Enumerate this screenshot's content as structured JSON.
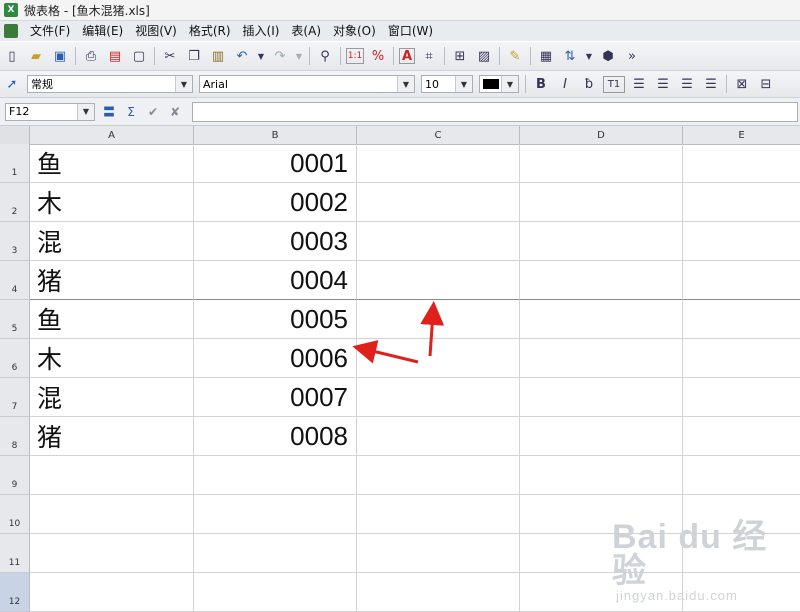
{
  "window": {
    "title": "微表格 - [鱼木混猪.xls]"
  },
  "menu": [
    "文件(F)",
    "编辑(E)",
    "视图(V)",
    "格式(R)",
    "插入(I)",
    "表(A)",
    "对象(O)",
    "窗口(W)"
  ],
  "toolbar": {
    "icons": [
      "new-file-icon",
      "open-folder-icon",
      "save-icon",
      "print-icon",
      "export-pdf-icon",
      "print-preview-icon",
      "cut-icon",
      "copy-icon",
      "paste-icon",
      "undo-icon",
      "redo-icon",
      "find-icon",
      "number-format-icon",
      "percent-icon",
      "text-frame-icon",
      "grid-icon",
      "borders-icon",
      "pattern-icon",
      "format-painter-icon",
      "chart-icon",
      "sort-icon",
      "gear-icon"
    ],
    "more": "»"
  },
  "format": {
    "style": "常规",
    "font": "Arial",
    "size": "10",
    "bold": "B",
    "italic": "I",
    "text_style": "T1"
  },
  "formula": {
    "cell_ref": "F12",
    "value": ""
  },
  "columns": [
    "A",
    "B",
    "C",
    "D",
    "E"
  ],
  "rows": [
    {
      "num": "1",
      "a": "鱼",
      "b": "0001"
    },
    {
      "num": "2",
      "a": "木",
      "b": "0002"
    },
    {
      "num": "3",
      "a": "混",
      "b": "0003"
    },
    {
      "num": "4",
      "a": "猪",
      "b": "0004"
    },
    {
      "num": "5",
      "a": "鱼",
      "b": "0005"
    },
    {
      "num": "6",
      "a": "木",
      "b": "0006"
    },
    {
      "num": "7",
      "a": "混",
      "b": "0007"
    },
    {
      "num": "8",
      "a": "猪",
      "b": "0008"
    },
    {
      "num": "9",
      "a": "",
      "b": ""
    },
    {
      "num": "10",
      "a": "",
      "b": ""
    },
    {
      "num": "11",
      "a": "",
      "b": ""
    },
    {
      "num": "12",
      "a": "",
      "b": ""
    }
  ],
  "watermark": {
    "brand": "Bai du 经验",
    "url": "jingyan.baidu.com"
  },
  "annotations": {
    "arrow_color": "#e0201b"
  }
}
